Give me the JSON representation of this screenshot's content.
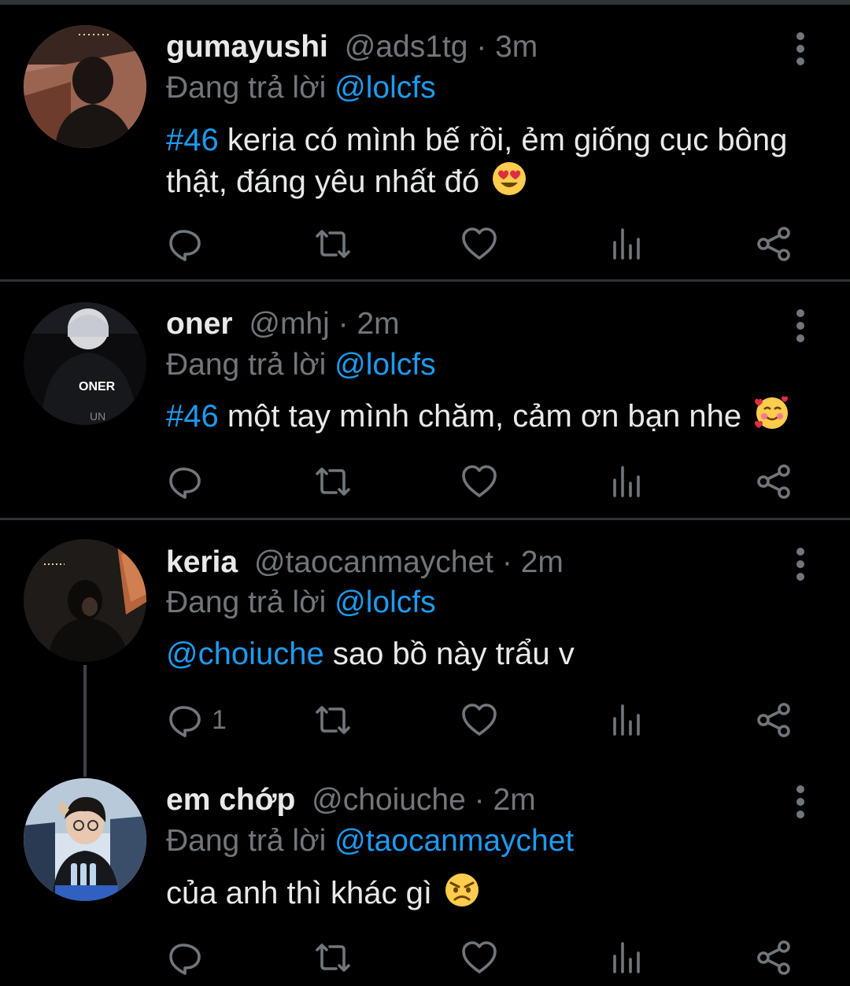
{
  "theme": {
    "background": "#000000",
    "text": "#e7e9ea",
    "muted": "#71767b",
    "link": "#1d9bf0",
    "divider": "#2f3336"
  },
  "tweets": [
    {
      "display_name": "gumayushi",
      "handle": "@ads1tg",
      "separator": "·",
      "time": "3m",
      "reply_prefix": "Đang trả lời",
      "reply_to": "@lolcfs",
      "body_link": "#46",
      "body_text": " keria có mình bế rồi, ẻm giống cục bông thật, đáng yêu nhất đó",
      "emoji": "heart-eyes-emoji",
      "reply_count": ""
    },
    {
      "display_name": "oner",
      "handle": "@mhj",
      "separator": "·",
      "time": "2m",
      "reply_prefix": "Đang trả lời",
      "reply_to": "@lolcfs",
      "body_link": "#46",
      "body_text": " một tay mình chăm, cảm ơn bạn nhe",
      "emoji": "smiling-hearts-emoji",
      "reply_count": "",
      "avatar_text": "ONER"
    },
    {
      "display_name": "keria",
      "handle": "@taocanmaychet",
      "separator": "·",
      "time": "2m",
      "reply_prefix": "Đang trả lời",
      "reply_to": "@lolcfs",
      "body_link": "@choiuche",
      "body_text": " sao bồ này trẩu v",
      "emoji": "",
      "reply_count": "1"
    },
    {
      "display_name": "em chớp",
      "handle": "@choiuche",
      "separator": "·",
      "time": "2m",
      "reply_prefix": "Đang trả lời",
      "reply_to": "@taocanmaychet",
      "body_link": "",
      "body_text": "của anh thì khác gì",
      "emoji": "angry-face-emoji",
      "reply_count": ""
    }
  ],
  "icons": {
    "reply": "reply-icon",
    "retweet": "retweet-icon",
    "like": "heart-icon",
    "views": "views-icon",
    "share": "share-icon",
    "more": "more-vertical-icon"
  }
}
